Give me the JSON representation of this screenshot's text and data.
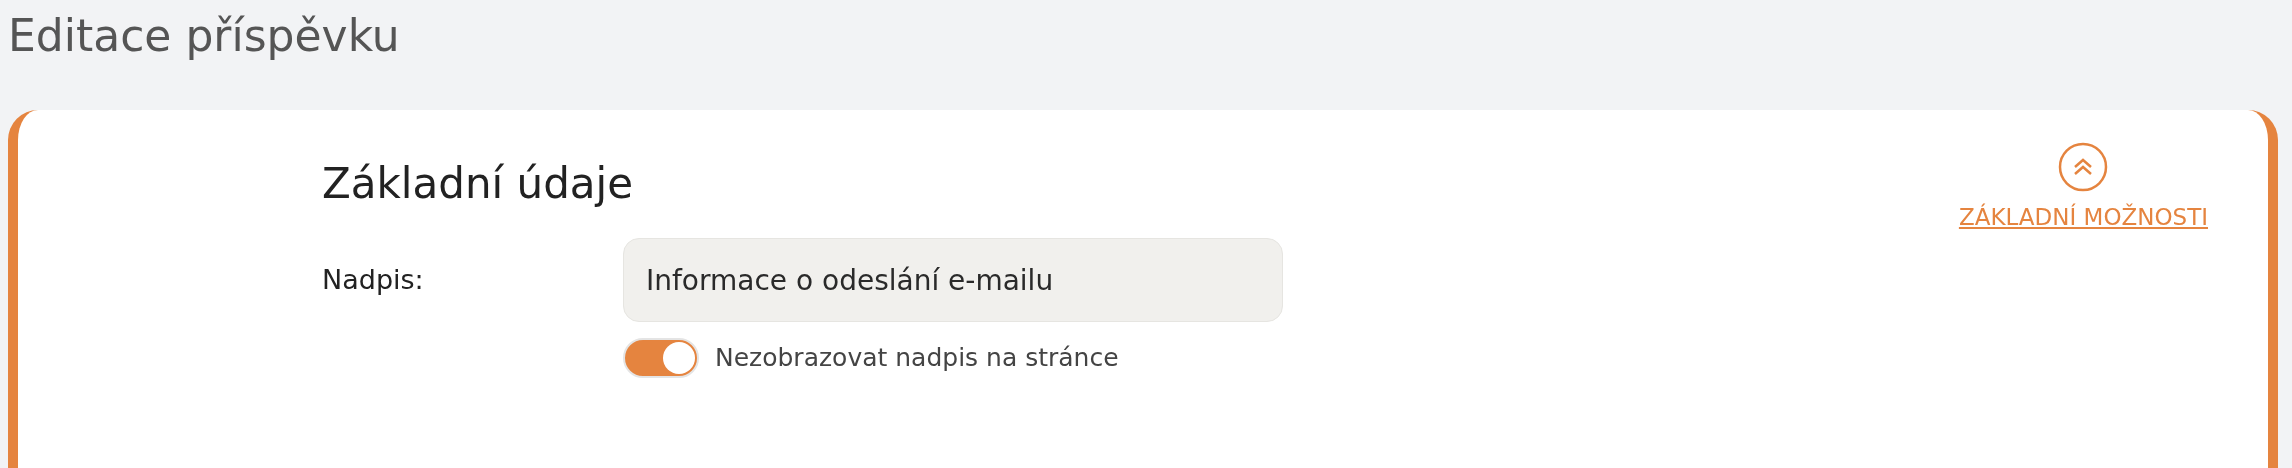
{
  "page_title": "Editace příspěvku",
  "section": {
    "title": "Základní údaje",
    "toggle_link": {
      "label": "ZÁKLADNÍ MOŽNOSTI",
      "expanded": true
    }
  },
  "fields": [
    {
      "label": "Nadpis:",
      "value": "Informace o odeslání e-mailu",
      "switch": {
        "label": "Nezobrazovat nadpis na stránce",
        "on": true
      }
    }
  ]
}
